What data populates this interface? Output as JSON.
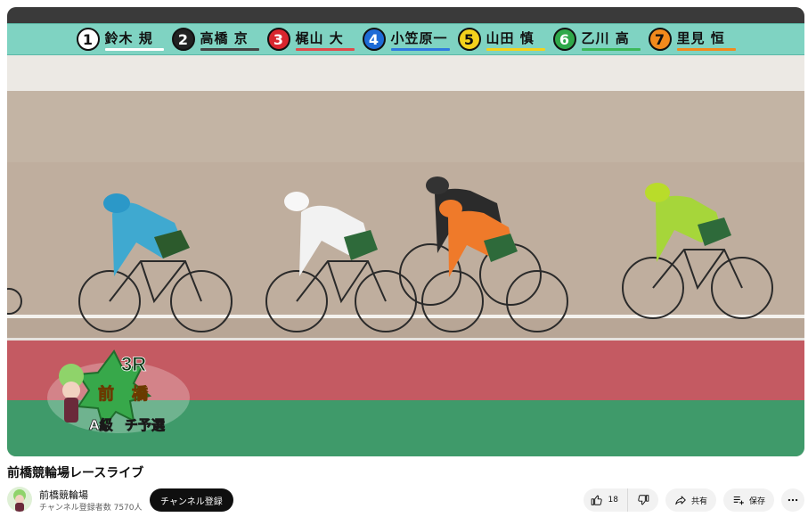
{
  "racers": [
    {
      "num": "1",
      "name": "鈴木 規",
      "bg": "#ffffff",
      "fg": "#111111",
      "line": "#ffffff"
    },
    {
      "num": "2",
      "name": "高橋 京",
      "bg": "#222222",
      "fg": "#ffffff",
      "line": "#444444"
    },
    {
      "num": "3",
      "name": "梶山 大",
      "bg": "#d8262e",
      "fg": "#ffffff",
      "line": "#e04a4a"
    },
    {
      "num": "4",
      "name": "小笠原一",
      "bg": "#1e6bd6",
      "fg": "#ffffff",
      "line": "#2f7be0"
    },
    {
      "num": "5",
      "name": "山田 慎",
      "bg": "#f4d21c",
      "fg": "#111111",
      "line": "#f4d21c"
    },
    {
      "num": "6",
      "name": "乙川 高",
      "bg": "#2fa84a",
      "fg": "#ffffff",
      "line": "#3cb85a"
    },
    {
      "num": "7",
      "name": "里見 恒",
      "bg": "#f28a1c",
      "fg": "#111111",
      "line": "#f28a1c"
    }
  ],
  "badge": {
    "race": "3R",
    "venue_left": "前",
    "venue_right": "橋",
    "class": "A級",
    "stage": "チ予選"
  },
  "video": {
    "title": "前橋競輪場レースライブ"
  },
  "channel": {
    "name": "前橋競輪場",
    "subscribers": "チャンネル登録者数 7570人",
    "subscribe_label": "チャンネル登録"
  },
  "actions": {
    "like_count": "18",
    "share_label": "共有",
    "save_label": "保存"
  },
  "icons": {
    "like": "thumbs-up-icon",
    "dislike": "thumbs-down-icon",
    "share": "share-icon",
    "save": "playlist-add-icon",
    "more": "more-horizontal-icon"
  }
}
